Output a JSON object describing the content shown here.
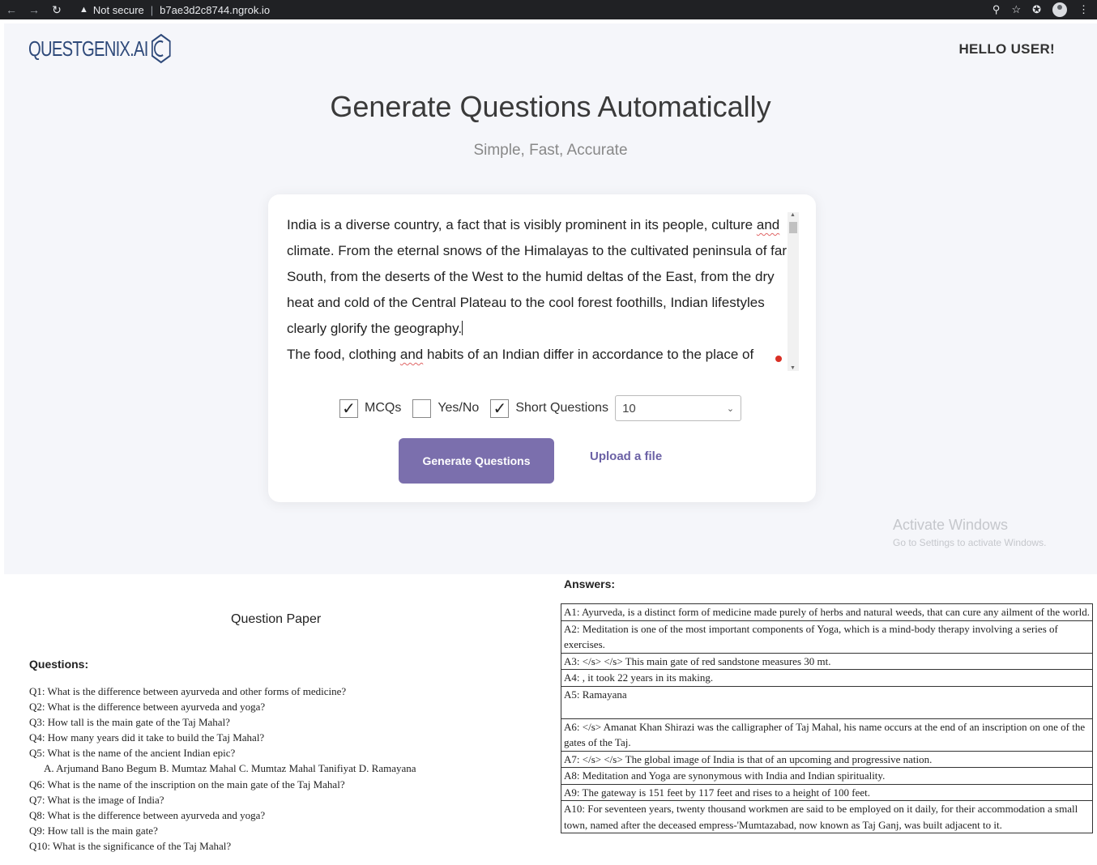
{
  "browser": {
    "security_label": "Not secure",
    "url": "b7ae3d2c8744.ngrok.io"
  },
  "header": {
    "logo_text": "QUESTGENIX.AI",
    "greeting": "HELLO USER!"
  },
  "hero": {
    "title": "Generate Questions Automatically",
    "subtitle": "Simple, Fast, Accurate"
  },
  "input": {
    "p1_line1_a": "India is a diverse country, a fact that is visibly prominent in its people, culture ",
    "p1_line1_b": "and",
    "p1_rest": "climate. From the eternal snows of the Himalayas to the cultivated peninsula of far South, from the deserts of the West to the humid deltas of the East, from the dry heat and cold of the Central Plateau to the cool forest foothills, Indian lifestyles clearly glorify the geography.",
    "p2_a": "The food, clothing ",
    "p2_b": "and",
    "p2_c": " habits of an Indian differ in accordance to the place of"
  },
  "options": {
    "mcq_label": "MCQs",
    "mcq_checked": true,
    "yesno_label": "Yes/No",
    "yesno_checked": false,
    "short_label": "Short Questions",
    "short_checked": true,
    "count_value": "10"
  },
  "actions": {
    "generate_label": "Generate Questions",
    "upload_label": "Upload a file"
  },
  "watermark": {
    "line1": "Activate Windows",
    "line2": "Go to Settings to activate Windows."
  },
  "paper": {
    "title": "Question Paper",
    "questions_heading": "Questions:",
    "questions": [
      "Q1: What is the difference between ayurveda and other forms of medicine?",
      "Q2: What is the difference between ayurveda and yoga?",
      "Q3: How tall is the main gate of the Taj Mahal?",
      "Q4: How many years did it take to build the Taj Mahal?",
      "Q5: What is the name of the ancient Indian epic?",
      "A. Arjumand Bano Begum  B. Mumtaz Mahal  C. Mumtaz Mahal Tanifiyat  D. Ramayana",
      "Q6: What is the name of the inscription on the main gate of the Taj Mahal?",
      "Q7: What is the image of India?",
      "Q8: What is the difference between ayurveda and yoga?",
      "Q9: How tall is the main gate?",
      "Q10: What is the significance of the Taj Mahal?"
    ]
  },
  "answers": {
    "heading": "Answers:",
    "items": [
      "A1: Ayurveda, is a distinct form of medicine made purely of herbs and natural weeds, that can cure any ailment of the world.",
      "A2: Meditation is one of the most important components of Yoga, which is a mind-body therapy involving a series of exercises.",
      "A3: </s> </s> This main gate of red sandstone measures 30 mt.",
      "A4: , it took 22 years in its making.",
      "A5: Ramayana",
      "A6: </s> Amanat Khan Shirazi was the calligrapher of Taj Mahal, his name occurs at the end of an inscription on one of the gates of the Taj.",
      "A7: </s> </s> The global image of India is that of an upcoming and progressive nation.",
      "A8: Meditation and Yoga are synonymous with India and Indian spirituality.",
      "A9: The gateway is 151 feet by 117 feet and rises to a height of 100 feet.",
      "A10: For seventeen years, twenty thousand workmen are said to be employed on it daily, for their accommodation a small town, named after the deceased empress-'Mumtazabad, now known as Taj Ganj, was built adjacent to it."
    ]
  }
}
